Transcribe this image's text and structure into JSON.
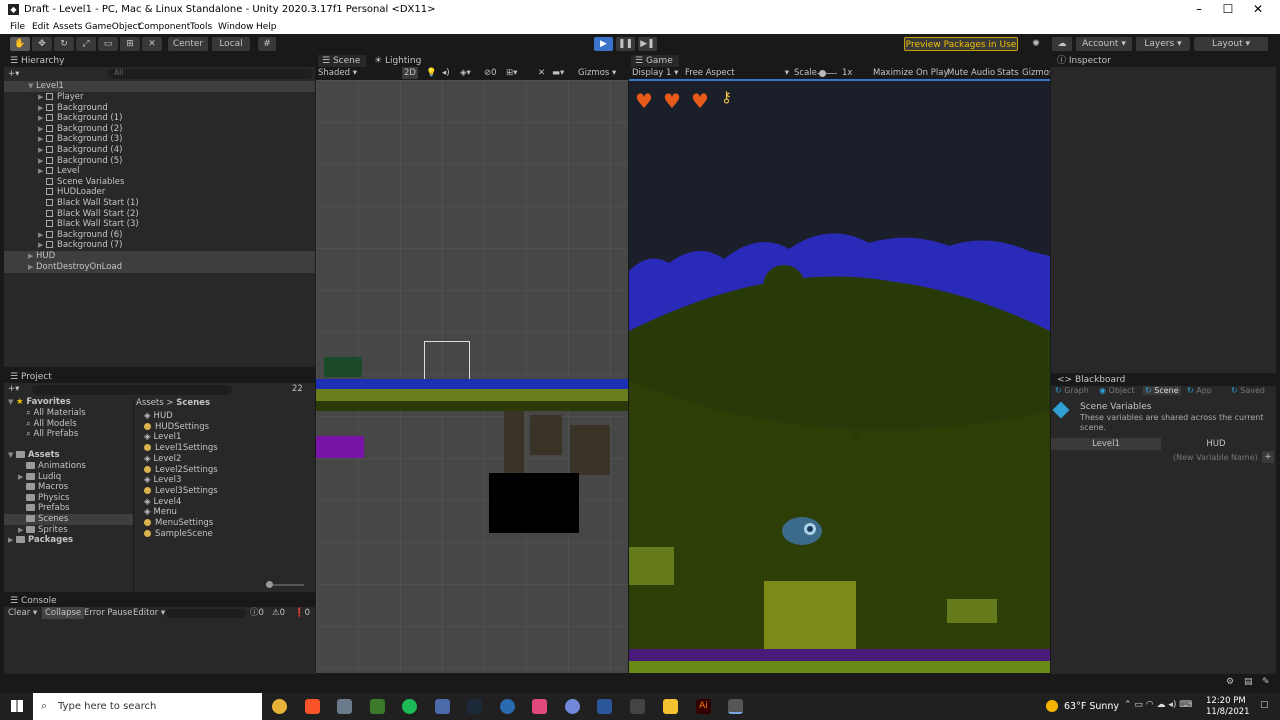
{
  "window": {
    "title": "Draft - Level1 - PC, Mac & Linux Standalone - Unity 2020.3.17f1 Personal <DX11>"
  },
  "menu": [
    "File",
    "Edit",
    "Assets",
    "GameObject",
    "Component",
    "Tools",
    "Window",
    "Help"
  ],
  "toolbar": {
    "center": "Center",
    "local": "Local",
    "preview": "Preview Packages in Use",
    "account": "Account",
    "layers": "Layers",
    "layout": "Layout"
  },
  "hierarchy": {
    "tab": "Hierarchy",
    "search_placeholder": "All",
    "scene": "Level1",
    "items": [
      "Player",
      "Background",
      "Background (1)",
      "Background (2)",
      "Background (3)",
      "Background (4)",
      "Background (5)",
      "Level",
      "Scene Variables",
      "HUDLoader",
      "Black Wall Start (1)",
      "Black Wall Start (2)",
      "Black Wall Start (3)",
      "Background (6)",
      "Background (7)"
    ],
    "roots": [
      "HUD",
      "DontDestroyOnLoad"
    ]
  },
  "project": {
    "tab": "Project",
    "count": "22",
    "favorites_label": "Favorites",
    "favorites": [
      "All Materials",
      "All Models",
      "All Prefabs"
    ],
    "assets_label": "Assets",
    "folders": [
      "Animations",
      "Ludiq",
      "Macros",
      "Physics",
      "Prefabs",
      "Scenes",
      "Sprites"
    ],
    "packages_label": "Packages",
    "breadcrumb": {
      "root": "Assets",
      "sep": ">",
      "current": "Scenes"
    },
    "files": [
      "HUD",
      "HUDSettings",
      "Level1",
      "Level1Settings",
      "Level2",
      "Level2Settings",
      "Level3",
      "Level3Settings",
      "Level4",
      "Menu",
      "MenuSettings",
      "SampleScene"
    ]
  },
  "console": {
    "tab": "Console",
    "clear": "Clear",
    "collapse": "Collapse",
    "error_pause": "Error Pause",
    "editor": "Editor",
    "counts": [
      "0",
      "0",
      "0"
    ]
  },
  "scene": {
    "tab": "Scene",
    "lighting_tab": "Lighting",
    "shading": "Shaded",
    "mode2d": "2D",
    "hidden_count": "0",
    "gizmos": "Gizmos"
  },
  "game": {
    "tab": "Game",
    "display": "Display 1",
    "aspect": "Free Aspect",
    "scale_label": "Scale",
    "scale_value": "1x",
    "maximize": "Maximize On Play",
    "mute": "Mute Audio",
    "stats": "Stats",
    "gizmos": "Gizmos",
    "hearts": 3
  },
  "inspector": {
    "tab": "Inspector"
  },
  "blackboard": {
    "tab": "Blackboard",
    "tabs": [
      "Graph",
      "Object",
      "Scene",
      "App",
      "Saved"
    ],
    "title": "Scene Variables",
    "description": "These variables are shared across the current scene.",
    "scene_tabs": [
      "Level1",
      "HUD"
    ],
    "new_var_placeholder": "(New Variable Name)"
  },
  "taskbar": {
    "search_placeholder": "Type here to search",
    "weather": "63°F  Sunny",
    "time": "12:20 PM",
    "date": "11/8/2021"
  },
  "colors": {
    "sky": "#1b1f2a",
    "mountains": "#2a2ab8",
    "hills": "#283a07",
    "ground": "#7e8a17",
    "accent": "#3a73c9",
    "heart": "#e85a1a"
  }
}
